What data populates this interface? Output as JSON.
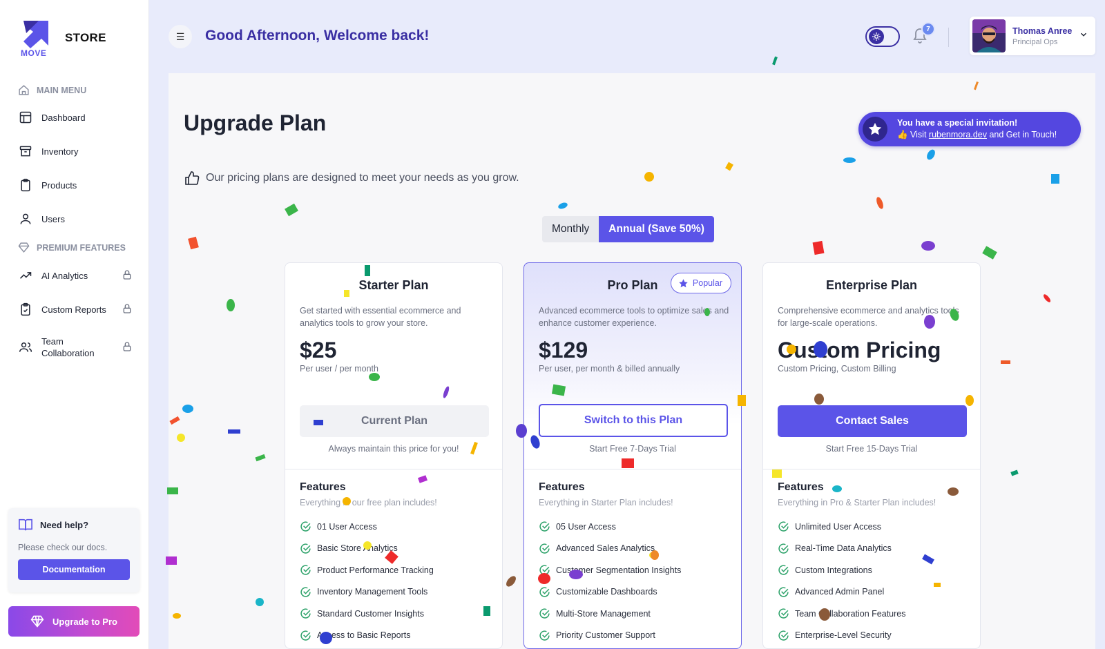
{
  "brand": {
    "name": "STORE",
    "sub": "MOVE"
  },
  "sidebar": {
    "main_menu_label": "MAIN MENU",
    "items": [
      {
        "label": "Dashboard",
        "icon": "dashboard-icon"
      },
      {
        "label": "Inventory",
        "icon": "archive-icon"
      },
      {
        "label": "Products",
        "icon": "clipboard-icon"
      },
      {
        "label": "Users",
        "icon": "user-icon"
      }
    ],
    "premium_label": "PREMIUM FEATURES",
    "premium_items": [
      {
        "label": "AI Analytics",
        "icon": "trend-up-icon",
        "locked": true
      },
      {
        "label": "Custom Reports",
        "icon": "clipboard-check-icon",
        "locked": true
      },
      {
        "label": "Team Collaboration",
        "label_line1": "Team",
        "label_line2": "Collaboration",
        "icon": "users-icon",
        "locked": true
      }
    ],
    "help": {
      "title": "Need help?",
      "text": "Please check our docs.",
      "button": "Documentation"
    },
    "upgrade_button": "Upgrade to Pro"
  },
  "header": {
    "greeting": "Good Afternoon, Welcome back!",
    "notifications_count": "7",
    "user": {
      "name": "Thomas Anree",
      "role": "Principal Ops"
    }
  },
  "page": {
    "title": "Upgrade Plan",
    "subtitle": "Our pricing plans are designed to meet your needs as you grow.",
    "invite": {
      "title": "You have a special invitation!",
      "prefix": "👍 Visit ",
      "link": "rubenmora.dev",
      "suffix": " and Get in Touch!"
    },
    "billing": {
      "monthly": "Monthly",
      "annual": "Annual (Save 50%)",
      "selected": "annual"
    }
  },
  "plans": [
    {
      "name": "Starter Plan",
      "description": "Get started with essential ecommerce and analytics tools to grow your store.",
      "price": "$25",
      "price_note": "Per user / per month",
      "button": "Current Plan",
      "button_note": "Always maintain this price for you!",
      "features_title": "Features",
      "features_sub": "Everything in our free plan includes!",
      "features": [
        "01 User Access",
        "Basic Store Analytics",
        "Product Performance Tracking",
        "Inventory Management Tools",
        "Standard Customer Insights",
        "Access to Basic Reports"
      ]
    },
    {
      "name": "Pro Plan",
      "badge": "Popular",
      "description": "Advanced ecommerce tools to optimize sales and enhance customer experience.",
      "price": "$129",
      "price_note": "Per user, per month & billed annually",
      "button": "Switch to this Plan",
      "button_note": "Start Free 7-Days Trial",
      "features_title": "Features",
      "features_sub": "Everything in Starter Plan includes!",
      "features": [
        "05 User Access",
        "Advanced Sales Analytics",
        "Customer Segmentation Insights",
        "Customizable Dashboards",
        "Multi-Store Management",
        "Priority Customer Support"
      ]
    },
    {
      "name": "Enterprise Plan",
      "description": "Comprehensive ecommerce and analytics tools for large-scale operations.",
      "price": "Custom Pricing",
      "price_note": "Custom Pricing, Custom Billing",
      "button": "Contact Sales",
      "button_note": "Start Free 15-Days Trial",
      "features_title": "Features",
      "features_sub": "Everything in Pro & Starter Plan includes!",
      "features": [
        "Unlimited User Access",
        "Real-Time Data Analytics",
        "Custom Integrations",
        "Advanced Admin Panel",
        "Team Collaboration Features",
        "Enterprise-Level Security"
      ]
    }
  ],
  "colors": {
    "accent": "#5b54e8",
    "greeting": "#3a2fa3",
    "check": "#2fa36b"
  }
}
